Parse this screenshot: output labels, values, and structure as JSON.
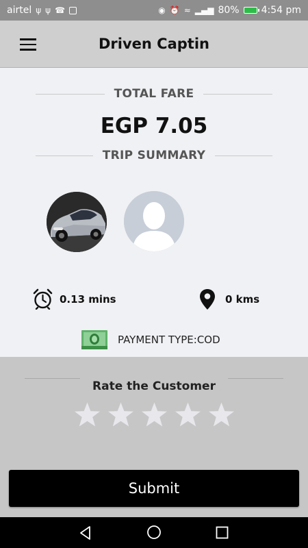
{
  "status_bar": {
    "carrier": "airtel",
    "battery": "80%",
    "time": "4:54 pm"
  },
  "app_bar": {
    "title": "Driven Captin",
    "menu_icon": "hamburger-menu-icon"
  },
  "fare": {
    "label": "TOTAL FARE",
    "amount": "EGP 7.05"
  },
  "trip_summary": {
    "label": "TRIP SUMMARY",
    "duration": "0.13 mins",
    "distance": "0 kms",
    "duration_icon": "alarm-clock-icon",
    "distance_icon": "location-pin-icon"
  },
  "payment": {
    "text": "PAYMENT TYPE:COD",
    "icon": "cash-money-icon"
  },
  "rating": {
    "title": "Rate the Customer",
    "stars_total": 5,
    "stars_selected": 0
  },
  "submit_label": "Submit",
  "colors": {
    "app_bar_bg": "#cfcfcf",
    "summary_bg": "#f0f1f4",
    "rate_bg": "#c6c6c6",
    "star_color": "#e7e7ec",
    "button_bg": "#000000"
  }
}
